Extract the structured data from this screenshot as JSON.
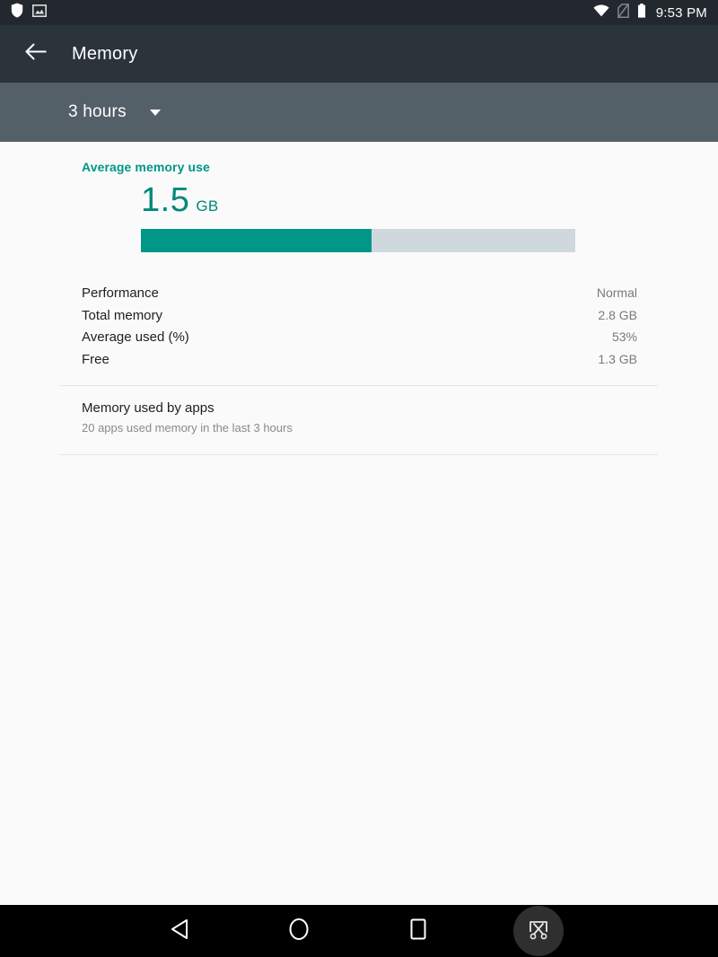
{
  "status_bar": {
    "icons_left": [
      "shield-icon",
      "image-icon"
    ],
    "icons_right": [
      "wifi-icon",
      "no-sim-icon",
      "battery-icon"
    ],
    "clock": "9:53 PM"
  },
  "app_bar": {
    "back_icon": "arrow-back-icon",
    "title": "Memory"
  },
  "spinner": {
    "selected": "3 hours",
    "caret_icon": "chevron-down-icon"
  },
  "summary": {
    "label": "Average memory use",
    "value": "1.5",
    "unit": "GB",
    "bar_percent": 53
  },
  "stats": [
    {
      "label": "Performance",
      "value": "Normal"
    },
    {
      "label": "Total memory",
      "value": "2.8 GB"
    },
    {
      "label": "Average used (%)",
      "value": "53%"
    },
    {
      "label": "Free",
      "value": "1.3 GB"
    }
  ],
  "apps_section": {
    "title": "Memory used by apps",
    "subtitle": "20 apps used memory in the last 3 hours"
  },
  "nav_bar": {
    "back": "back-triangle-icon",
    "home": "home-circle-icon",
    "recents": "recents-square-icon",
    "screenshot": "screenshot-scissors-icon"
  },
  "colors": {
    "accent": "#009688",
    "track": "#cfd8dc",
    "app_bar": "#2b333b",
    "spinner_bar": "#546068",
    "status_bar": "#22282e",
    "background": "#fafafa"
  }
}
